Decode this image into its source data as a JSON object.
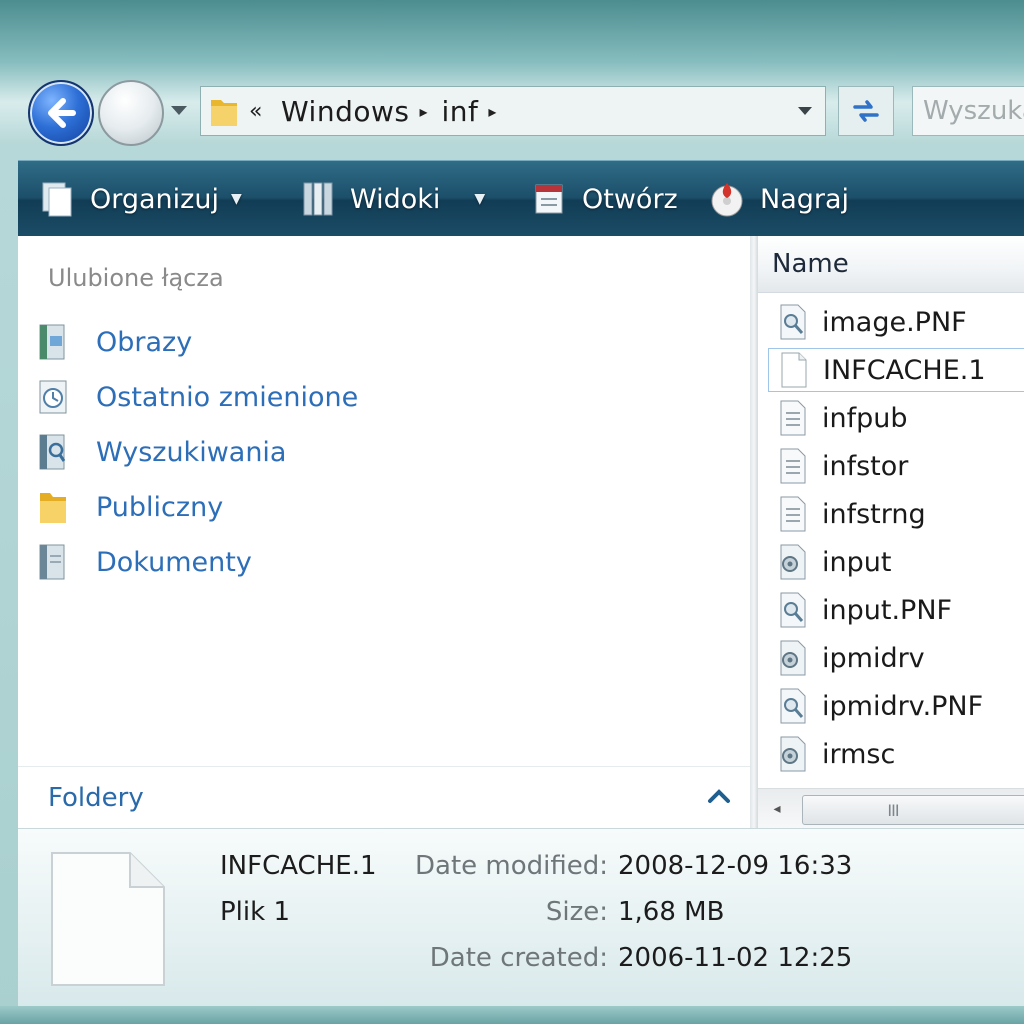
{
  "address_bar": {
    "prefix": "«",
    "breadcrumbs": [
      "Windows",
      "inf"
    ],
    "separator": "▸"
  },
  "search": {
    "placeholder": "Wyszukaj"
  },
  "toolbar": {
    "organize_label": "Organizuj",
    "views_label": "Widoki",
    "open_label": "Otwórz",
    "burn_label": "Nagraj",
    "dropdown_glyph": "▼"
  },
  "nav_pane": {
    "title": "Ulubione łącza",
    "links": [
      {
        "label": "Obrazy",
        "icon": "pictures-icon"
      },
      {
        "label": "Ostatnio zmienione",
        "icon": "recent-icon"
      },
      {
        "label": "Wyszukiwania",
        "icon": "searches-icon"
      },
      {
        "label": "Publiczny",
        "icon": "public-folder-icon"
      },
      {
        "label": "Dokumenty",
        "icon": "documents-icon"
      }
    ],
    "folders_label": "Foldery"
  },
  "file_list": {
    "column_name": "Name",
    "selected_index": 1,
    "files": [
      {
        "name": "image.PNF",
        "icon": "pnf-file-icon"
      },
      {
        "name": "INFCACHE.1",
        "icon": "blank-file-icon"
      },
      {
        "name": "infpub",
        "icon": "text-file-icon"
      },
      {
        "name": "infstor",
        "icon": "text-file-icon"
      },
      {
        "name": "infstrng",
        "icon": "text-file-icon"
      },
      {
        "name": "input",
        "icon": "setup-info-icon"
      },
      {
        "name": "input.PNF",
        "icon": "pnf-file-icon"
      },
      {
        "name": "ipmidrv",
        "icon": "setup-info-icon"
      },
      {
        "name": "ipmidrv.PNF",
        "icon": "pnf-file-icon"
      },
      {
        "name": "irmsc",
        "icon": "setup-info-icon"
      }
    ],
    "scroll_grip": "III"
  },
  "details": {
    "name": "INFCACHE.1",
    "type": "Plik 1",
    "date_modified_label": "Date modified:",
    "date_modified": "2008-12-09 16:33",
    "size_label": "Size:",
    "size": "1,68 MB",
    "date_created_label": "Date created:",
    "date_created": "2006-11-02 12:25"
  },
  "colors": {
    "toolbar": "#1c4f6a",
    "link": "#2d6eb8",
    "selection_border": "#9fc5e8"
  }
}
